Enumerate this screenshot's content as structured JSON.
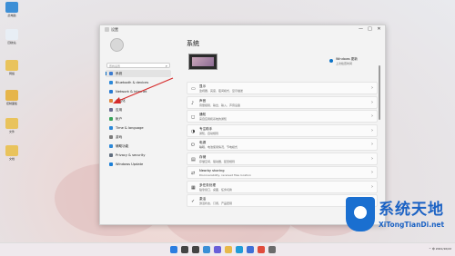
{
  "desktop": {
    "icons": [
      {
        "label": "此电脑",
        "color": "#3d8fd6"
      },
      {
        "label": "回收站",
        "color": "#e8eef5"
      },
      {
        "label": "网络",
        "color": "#e9c35c"
      },
      {
        "label": "控制面板",
        "color": "#e6b54a"
      },
      {
        "label": "文件",
        "color": "#e9c35c"
      },
      {
        "label": "文档",
        "color": "#e9c35c"
      }
    ]
  },
  "window": {
    "title": "设置",
    "controls": {
      "minimize": "—",
      "maximize": "□",
      "close": "✕"
    }
  },
  "sidebar": {
    "search_placeholder": "查找设置",
    "items": [
      {
        "label": "系统",
        "icon": "system-icon",
        "color": "#3b7bd0",
        "active": true
      },
      {
        "label": "Bluetooth & devices",
        "icon": "bluetooth-icon",
        "color": "#2b88d8",
        "active": false
      },
      {
        "label": "Network & internet",
        "icon": "network-icon",
        "color": "#2a7bd1",
        "active": false
      },
      {
        "label": "个性化",
        "icon": "personalization-icon",
        "color": "#e0863d",
        "active": false
      },
      {
        "label": "应用",
        "icon": "apps-icon",
        "color": "#6b6b8f",
        "active": false
      },
      {
        "label": "帐户",
        "icon": "accounts-icon",
        "color": "#38a35a",
        "active": false
      },
      {
        "label": "Time & language",
        "icon": "time-language-icon",
        "color": "#2b88d8",
        "active": false
      },
      {
        "label": "游戏",
        "icon": "gaming-icon",
        "color": "#7a7a7a",
        "active": false
      },
      {
        "label": "辅助功能",
        "icon": "accessibility-icon",
        "color": "#2b88d8",
        "active": false
      },
      {
        "label": "Privacy & security",
        "icon": "privacy-icon",
        "color": "#5f6d7e",
        "active": false
      },
      {
        "label": "Windows Update",
        "icon": "windows-update-icon",
        "color": "#1b7fd8",
        "active": false
      }
    ]
  },
  "main": {
    "page_title": "系统",
    "update": {
      "title": "Windows 更新",
      "subtitle": "上次检查时间"
    },
    "cards": [
      {
        "icon": "display-icon",
        "glyph": "▭",
        "title": "显示",
        "subtitle": "监视器、亮度、夜间模式、显示描述"
      },
      {
        "icon": "sound-icon",
        "glyph": "♪",
        "title": "声音",
        "subtitle": "音量级别、输出、输入、声音设备"
      },
      {
        "icon": "notifications-icon",
        "glyph": "◻",
        "title": "通知",
        "subtitle": "来自应用和系统的通知"
      },
      {
        "icon": "focus-assist-icon",
        "glyph": "◑",
        "title": "专注助手",
        "subtitle": "通知、自动规则"
      },
      {
        "icon": "power-icon",
        "glyph": "⏻",
        "title": "电源",
        "subtitle": "睡眠、电池使用情况、节电模式"
      },
      {
        "icon": "storage-icon",
        "glyph": "▤",
        "title": "存储",
        "subtitle": "存储空间、驱动器、配置规则"
      },
      {
        "icon": "nearby-sharing-icon",
        "glyph": "⇄",
        "title": "Nearby sharing",
        "subtitle": "Discoverability, received files location"
      },
      {
        "icon": "multitasking-icon",
        "glyph": "▦",
        "title": "多任务处理",
        "subtitle": "贴靠窗口、桌面、任务切换"
      },
      {
        "icon": "activation-icon",
        "glyph": "✓",
        "title": "激活",
        "subtitle": "激活状态、订阅、产品密钥"
      }
    ]
  },
  "taskbar": {
    "icons": [
      {
        "name": "start-icon",
        "color": "#2b7de0"
      },
      {
        "name": "search-icon",
        "color": "#444444"
      },
      {
        "name": "task-view-icon",
        "color": "#444444"
      },
      {
        "name": "widgets-icon",
        "color": "#3a8fd6"
      },
      {
        "name": "chat-icon",
        "color": "#6a5fd8"
      },
      {
        "name": "explorer-icon",
        "color": "#e8b84a"
      },
      {
        "name": "edge-icon",
        "color": "#1f9bd8"
      },
      {
        "name": "store-icon",
        "color": "#3f6fd6"
      },
      {
        "name": "chrome-icon",
        "color": "#e04b3c"
      },
      {
        "name": "settings-icon",
        "color": "#6b6b6b"
      }
    ],
    "tray": "^ 中 2021/10/22"
  },
  "watermark": {
    "cn": "系统天地",
    "en": "XiTongTianDi.net"
  },
  "colors": {
    "accent": "#0067c0",
    "annotation_arrow": "#d62b2b"
  }
}
